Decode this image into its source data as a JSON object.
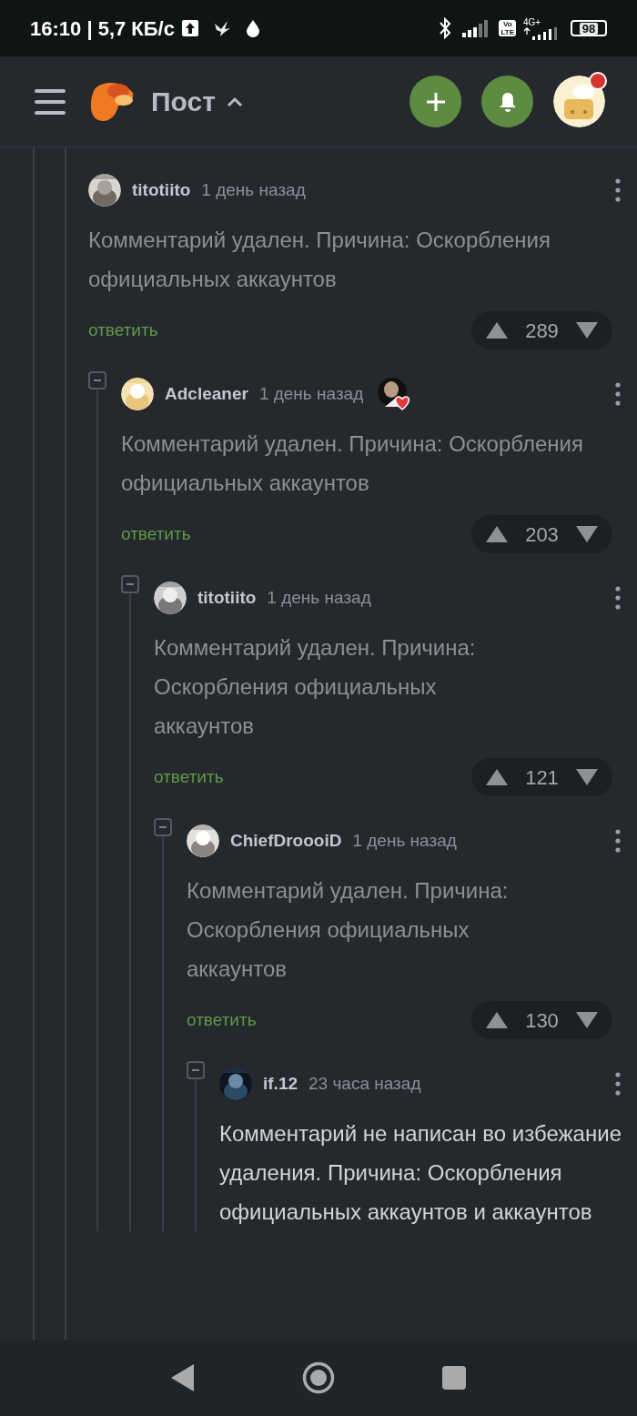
{
  "status_bar": {
    "time_speed": "16:10 | 5,7 КБ/с",
    "volte_top": "Vo",
    "volte_bottom": "LTE",
    "network": "4G+",
    "battery": "98"
  },
  "header": {
    "title": "Пост",
    "has_notification": true
  },
  "comments": [
    {
      "author": "titotiito",
      "time": "1 день назад",
      "text": "Комментарий удален. Причина: Оскорбления официальных аккаунтов",
      "deleted": true,
      "reply": "ответить",
      "rating": "289",
      "children": [
        {
          "author": "Adcleaner",
          "time": "1 день назад",
          "text": "Комментарий удален. Причина: Оскорбления официальных аккаунтов",
          "deleted": true,
          "reply": "ответить",
          "rating": "203",
          "children": [
            {
              "author": "titotiito",
              "time": "1 день назад",
              "text": "Комментарий удален. Причина: Оскорбления официальных аккаунтов",
              "deleted": true,
              "reply": "ответить",
              "rating": "121",
              "children": [
                {
                  "author": "ChiefDroooiD",
                  "time": "1 день назад",
                  "text": "Комментарий удален. Причина: Оскорбления официальных аккаунтов",
                  "deleted": true,
                  "reply": "ответить",
                  "rating": "130",
                  "children": [
                    {
                      "author": "if.12",
                      "time": "23 часа назад",
                      "text": "Комментарий не написан во избежание удаления. Причина: Оскорбления официальных аккаунтов и аккаунтов",
                      "deleted": false
                    }
                  ]
                }
              ]
            }
          ]
        }
      ]
    }
  ]
}
